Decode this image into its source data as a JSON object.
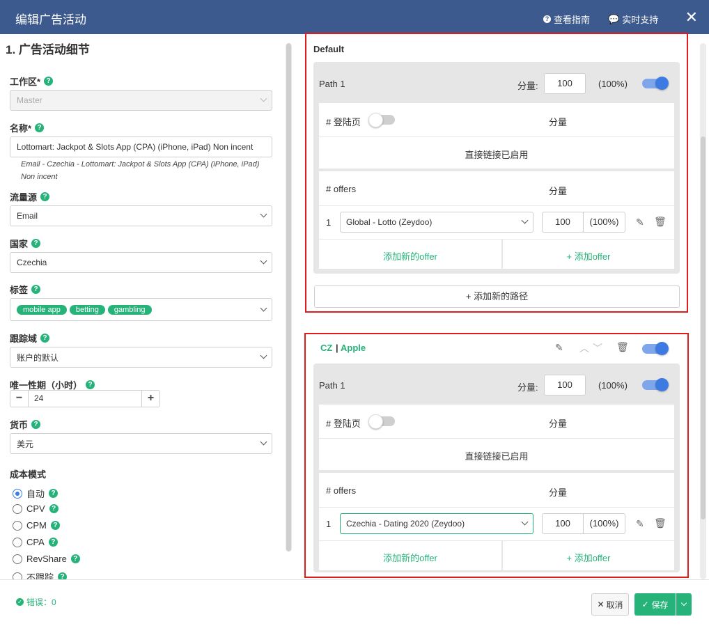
{
  "window": {
    "title": "编辑广告活动",
    "guide_link": "查看指南",
    "support_link": "实时支持",
    "close": "✕"
  },
  "campaign": {
    "section_title": "1. 广告活动细节",
    "workspace": {
      "label": "工作区*",
      "value": "Master"
    },
    "name": {
      "label": "名称*",
      "value": "Lottomart: Jackpot & Slots App (CPA) (iPhone, iPad) Non incent",
      "hint": "Email - Czechia - Lottomart: Jackpot & Slots App (CPA) (iPhone, iPad) Non incent"
    },
    "traffic_source": {
      "label": "流量源",
      "value": "Email"
    },
    "country": {
      "label": "国家",
      "value": "Czechia"
    },
    "tags": {
      "label": "标签",
      "values": [
        "mobile app",
        "betting",
        "gambling"
      ]
    },
    "tracking_domain": {
      "label": "跟踪域",
      "value": "账户的默认"
    },
    "uniqueness": {
      "label": "唯一性期（小时）",
      "value": "24",
      "minus": "−",
      "plus": "+"
    },
    "currency": {
      "label": "货币",
      "value": "美元"
    },
    "cost_model": {
      "label": "成本模式",
      "options": [
        "自动",
        "CPV",
        "CPM",
        "CPA",
        "RevShare",
        "不跟踪"
      ],
      "selected": "自动"
    }
  },
  "default_flow": {
    "title": "Default",
    "path": {
      "name": "Path 1",
      "weight_label": "分量:",
      "weight": "100",
      "percent": "(100%)"
    },
    "landers": {
      "header": "# 登陆页",
      "weight_header": "分量",
      "direct": "直接链接已启用"
    },
    "offers": {
      "header": "# offers",
      "weight_header": "分量",
      "row_num": "1",
      "offer": "Global - Lotto (Zeydoo)",
      "weight": "100",
      "percent": "(100%)"
    },
    "add_new_offer": "添加新的offer",
    "add_offer": "+ 添加offer",
    "add_path": "+ 添加新的路径"
  },
  "rule_flow": {
    "country": "CZ",
    "separator": "|",
    "device": "Apple",
    "path": {
      "name": "Path 1",
      "weight_label": "分量:",
      "weight": "100",
      "percent": "(100%)"
    },
    "landers": {
      "header": "# 登陆页",
      "weight_header": "分量",
      "direct": "直接链接已启用"
    },
    "offers": {
      "header": "# offers",
      "weight_header": "分量",
      "row_num": "1",
      "offer": "Czechia - Dating 2020 (Zeydoo)",
      "weight": "100",
      "percent": "(100%)"
    },
    "add_new_offer": "添加新的offer",
    "add_offer": "+ 添加offer"
  },
  "footer": {
    "errors": "错误：0",
    "cancel": "取消",
    "save": "保存"
  },
  "icons": {
    "help": "?",
    "pencil": "✎",
    "trash": "🗑",
    "check": "✓"
  }
}
